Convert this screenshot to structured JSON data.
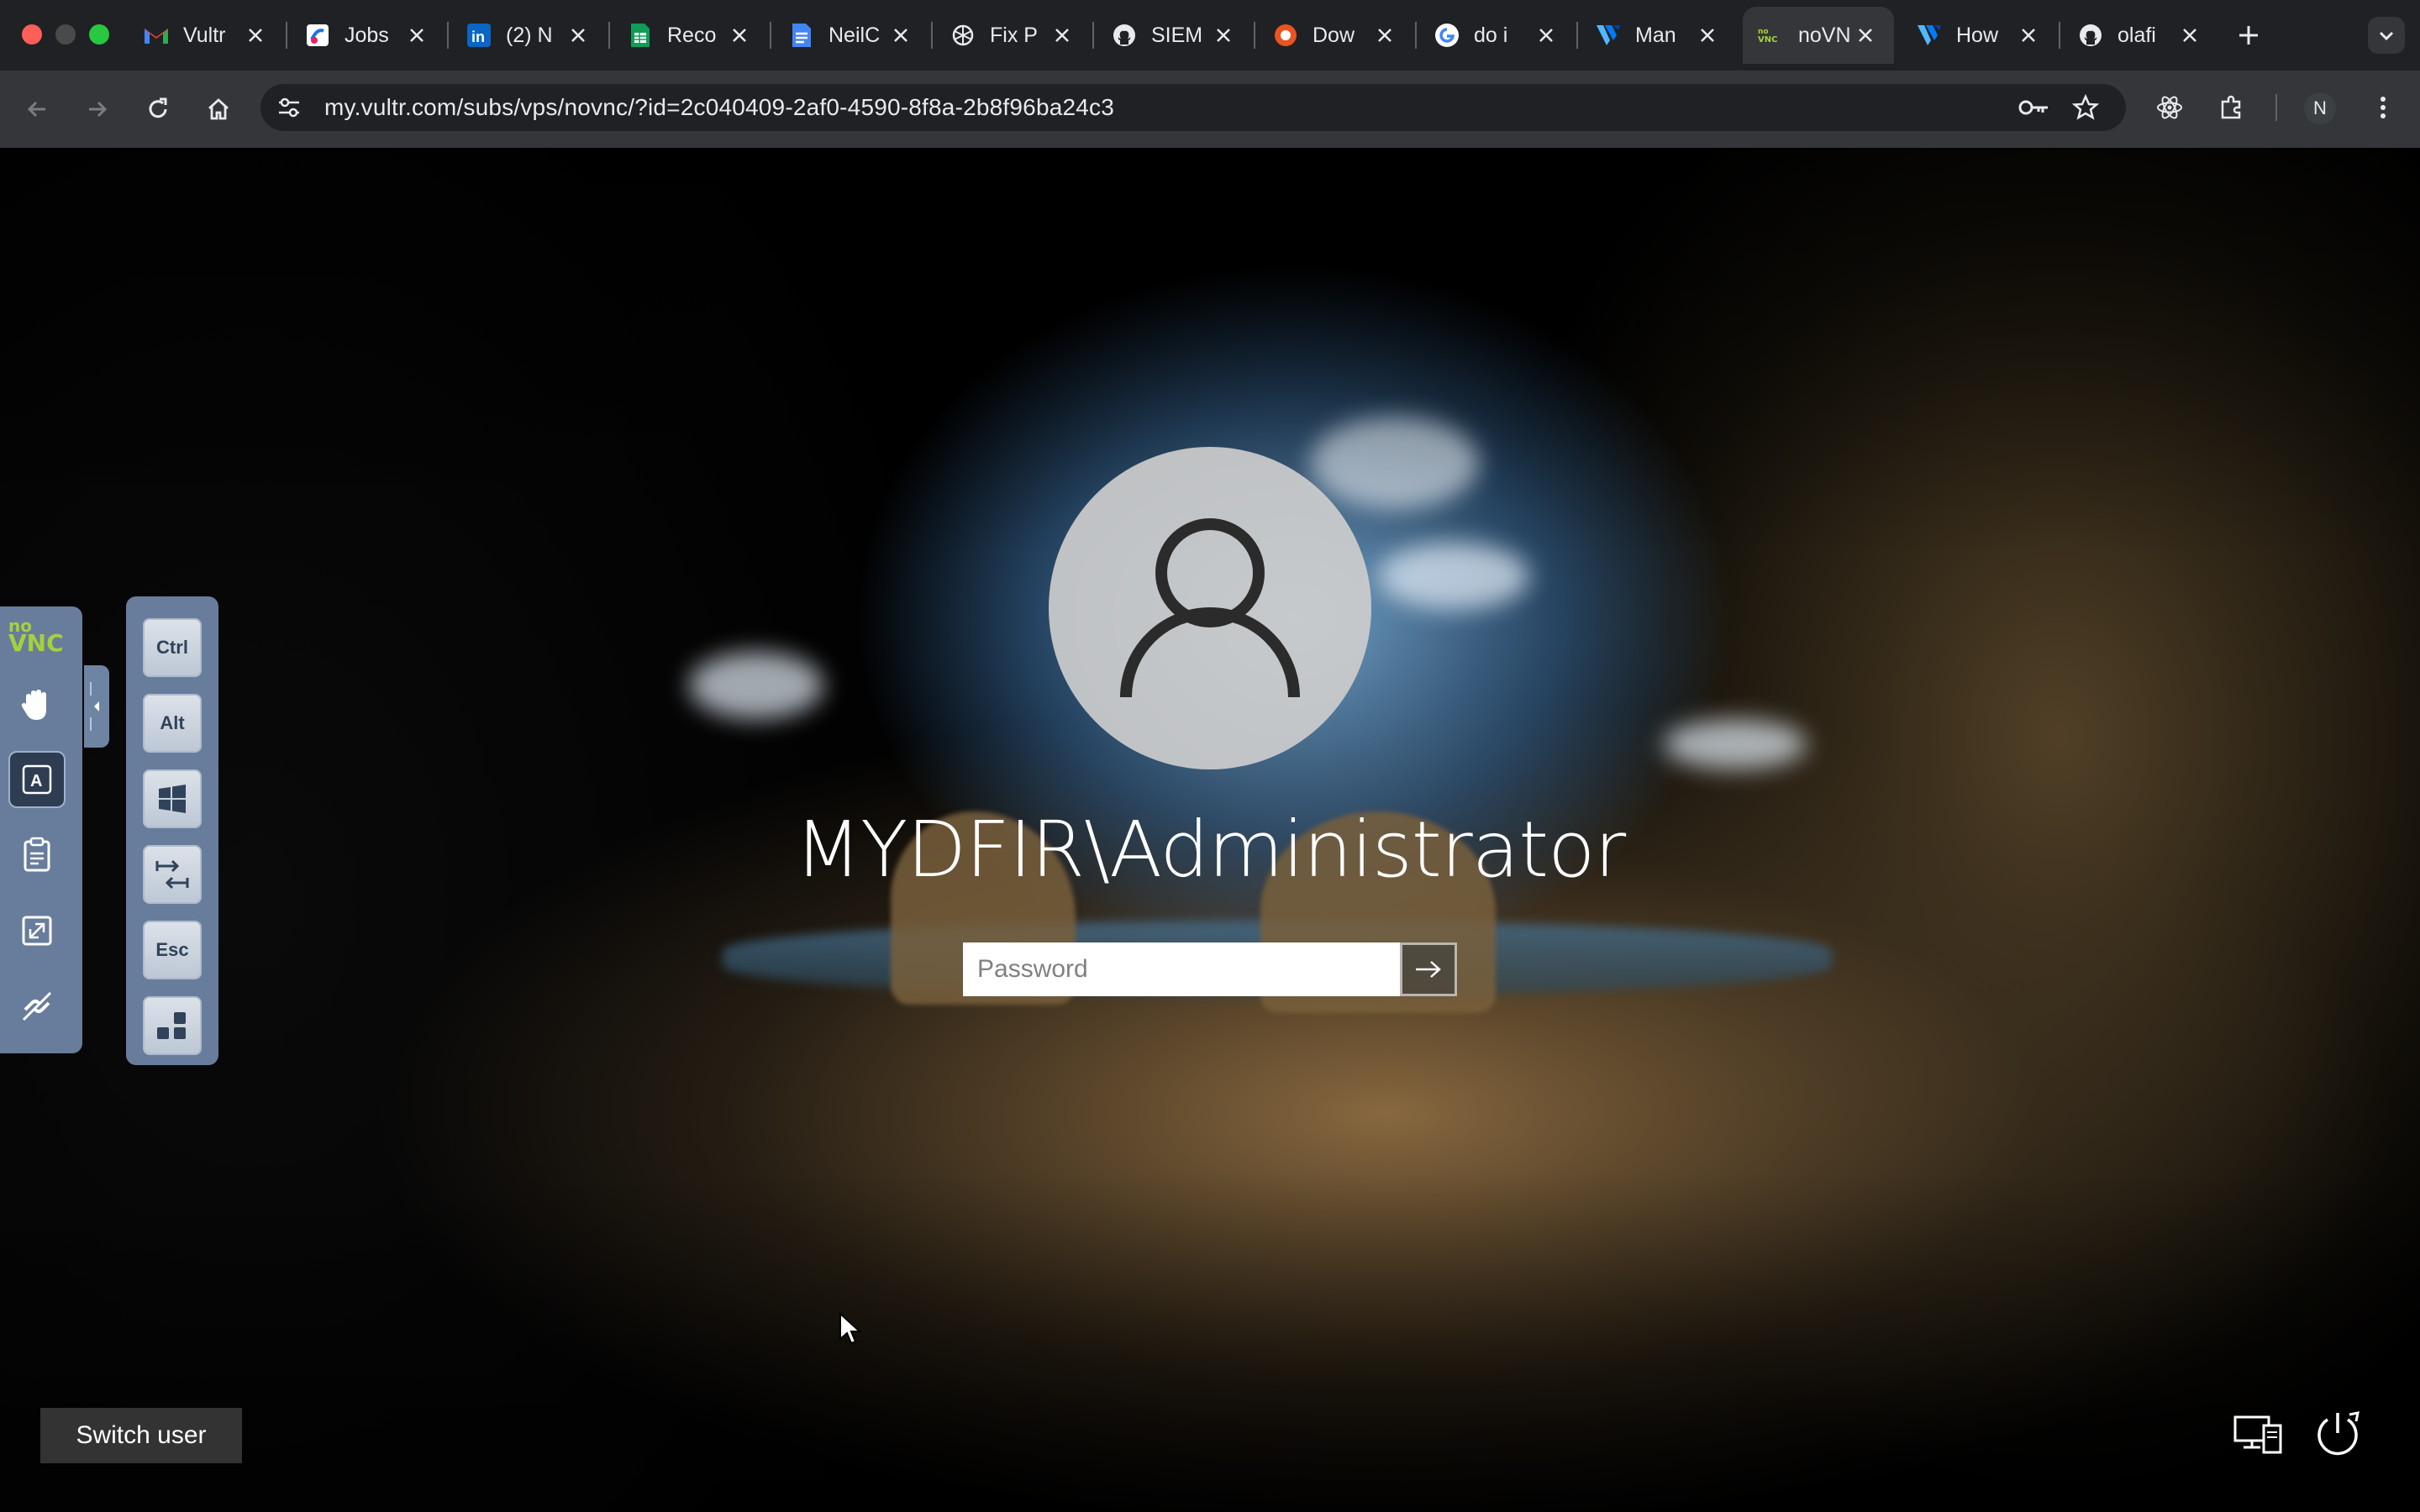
{
  "browser": {
    "tabs": [
      {
        "title": "Vultr",
        "favicon": "gmail-icon"
      },
      {
        "title": "Jobs",
        "favicon": "jobs-icon"
      },
      {
        "title": "(2) N",
        "favicon": "linkedin-icon"
      },
      {
        "title": "Reco",
        "favicon": "sheets-icon"
      },
      {
        "title": "NeilC",
        "favicon": "docs-icon"
      },
      {
        "title": "Fix P",
        "favicon": "openai-icon"
      },
      {
        "title": "SIEM",
        "favicon": "github-icon"
      },
      {
        "title": "Dow",
        "favicon": "download-site-icon"
      },
      {
        "title": "do i",
        "favicon": "google-icon"
      },
      {
        "title": "Man",
        "favicon": "vultr-icon"
      },
      {
        "title": "noVN",
        "favicon": "novnc-icon",
        "active": true
      },
      {
        "title": "How",
        "favicon": "vultr-icon"
      },
      {
        "title": "olafi",
        "favicon": "github-icon"
      }
    ],
    "url": "my.vultr.com/subs/vps/novnc/?id=2c040409-2af0-4590-8f8a-2b8f96ba24c3",
    "profile_initial": "N"
  },
  "novnc": {
    "logo_top": "no",
    "logo_bottom": "VNC",
    "extra_keys": [
      "Ctrl",
      "Alt",
      "Esc"
    ]
  },
  "login": {
    "username": "MYDFIR\\Administrator",
    "password_placeholder": "Password",
    "switch_user": "Switch user"
  },
  "colors": {
    "chrome_dark": "#202124",
    "chrome_toolbar": "#35363a",
    "novnc_panel": "#6e84a3",
    "novnc_logo": "#a5d13c"
  }
}
